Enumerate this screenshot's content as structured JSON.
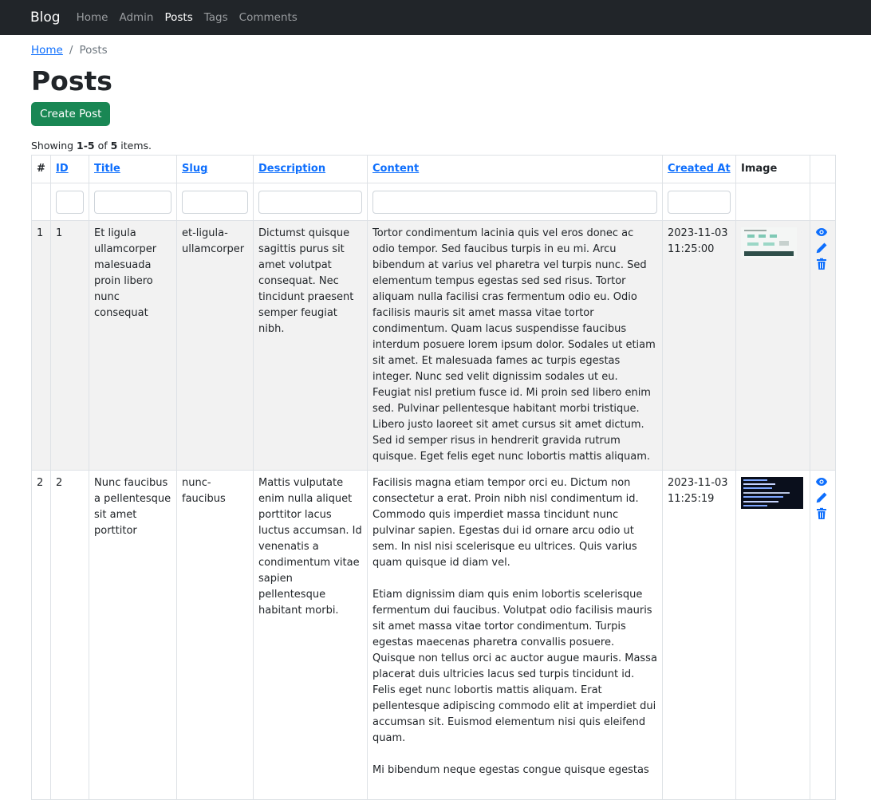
{
  "navbar": {
    "brand": "Blog",
    "links": [
      {
        "label": "Home",
        "active": false
      },
      {
        "label": "Admin",
        "active": false
      },
      {
        "label": "Posts",
        "active": true
      },
      {
        "label": "Tags",
        "active": false
      },
      {
        "label": "Comments",
        "active": false
      }
    ]
  },
  "breadcrumb": {
    "home": "Home",
    "separator": "/",
    "current": "Posts"
  },
  "page": {
    "title": "Posts",
    "create_label": "Create Post",
    "summary_prefix": "Showing ",
    "summary_range": "1-5",
    "summary_mid": " of ",
    "summary_total": "5",
    "summary_suffix": " items."
  },
  "table": {
    "headers": {
      "num": "#",
      "id": "ID",
      "title": "Title",
      "slug": "Slug",
      "description": "Description",
      "content": "Content",
      "created_at": "Created At",
      "image": "Image"
    },
    "rows": [
      {
        "num": "1",
        "id": "1",
        "title": "Et ligula ullamcorper malesuada proin libero nunc consequat",
        "slug": "et-ligula-ullamcorper",
        "description": "Dictumst quisque sagittis purus sit amet volutpat consequat. Nec tincidunt praesent semper feugiat nibh.",
        "content": [
          "Tortor condimentum lacinia quis vel eros donec ac odio tempor. Sed faucibus turpis in eu mi. Arcu bibendum at varius vel pharetra vel turpis nunc. Sed elementum tempus egestas sed sed risus. Tortor aliquam nulla facilisi cras fermentum odio eu. Odio facilisis mauris sit amet massa vitae tortor condimentum. Quam lacus suspendisse faucibus interdum posuere lorem ipsum dolor. Sodales ut etiam sit amet. Et malesuada fames ac turpis egestas integer. Nunc sed velit dignissim sodales ut eu. Feugiat nisl pretium fusce id. Mi proin sed libero enim sed. Pulvinar pellentesque habitant morbi tristique. Libero justo laoreet sit amet cursus sit amet dictum. Sed id semper risus in hendrerit gravida rutrum quisque. Eget felis eget nunc lobortis mattis aliquam."
        ],
        "created_at": "2023-11-03 11:25:00"
      },
      {
        "num": "2",
        "id": "2",
        "title": "Nunc faucibus a pellentesque sit amet porttitor",
        "slug": "nunc-faucibus",
        "description": "Mattis vulputate enim nulla aliquet porttitor lacus luctus accumsan. Id venenatis a condimentum vitae sapien pellentesque habitant morbi.",
        "content": [
          "Facilisis magna etiam tempor orci eu. Dictum non consectetur a erat. Proin nibh nisl condimentum id. Commodo quis imperdiet massa tincidunt nunc pulvinar sapien. Egestas dui id ornare arcu odio ut sem. In nisl nisi scelerisque eu ultrices. Quis varius quam quisque id diam vel.",
          "Etiam dignissim diam quis enim lobortis scelerisque fermentum dui faucibus. Volutpat odio facilisis mauris sit amet massa vitae tortor condimentum. Turpis egestas maecenas pharetra convallis posuere. Quisque non tellus orci ac auctor augue mauris. Massa placerat duis ultricies lacus sed turpis tincidunt id. Felis eget nunc lobortis mattis aliquam. Erat pellentesque adipiscing commodo elit at imperdiet dui accumsan sit. Euismod elementum nisi quis eleifend quam.",
          "Mi bibendum neque egestas congue quisque egestas"
        ],
        "created_at": "2023-11-03 11:25:19"
      }
    ]
  },
  "colors": {
    "navbar": "#212529",
    "link": "#0d6efd",
    "success": "#198754"
  },
  "icons": [
    "eye-icon",
    "pencil-icon",
    "trash-icon"
  ]
}
